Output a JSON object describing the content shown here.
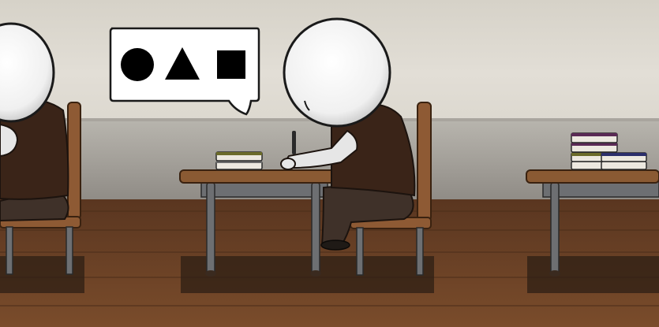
{
  "scene": {
    "description_elements": [
      "wall",
      "floor",
      "desks",
      "chairs",
      "students",
      "books",
      "speech-bubble"
    ],
    "speech_bubble": {
      "shapes": [
        "circle",
        "triangle",
        "square"
      ]
    },
    "colors": {
      "wall_top": "#dcd8cf",
      "wall_mid": "#bbb8b2",
      "floor": "#6e4426",
      "desk_top": "#8a5a33",
      "chair": "#8e5a34",
      "sweater": "#3a2418",
      "pants": "#3f3129",
      "shadow": "#2e1f14",
      "metal": "#6d6f72",
      "book_olive": "#6b6b2a",
      "book_purple": "#5a2a55",
      "book_navy": "#2c2f6b",
      "book_page": "#ece8df"
    }
  }
}
